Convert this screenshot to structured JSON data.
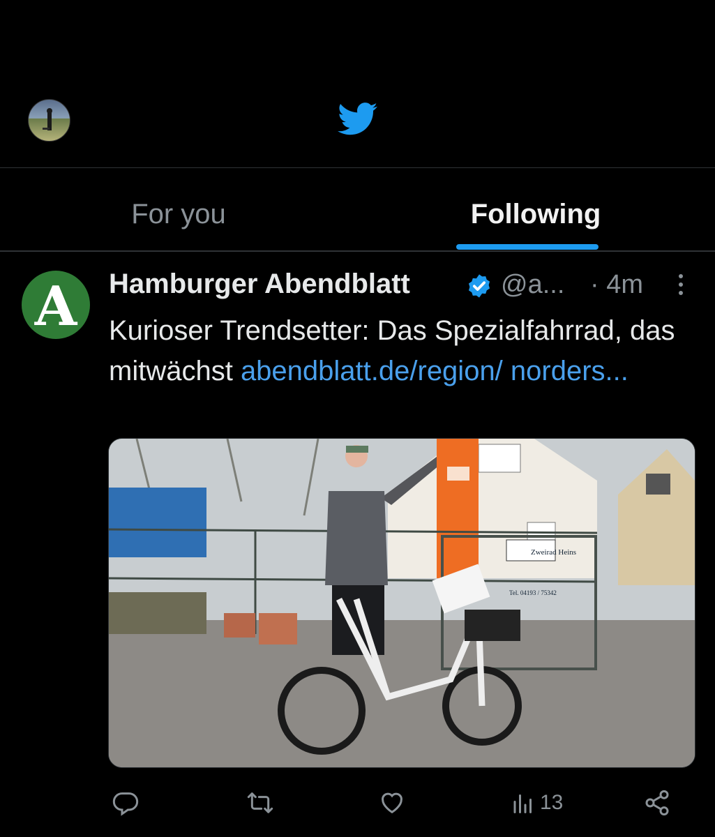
{
  "header": {
    "logo_icon": "twitter-bird-icon",
    "avatar_icon": "profile-avatar"
  },
  "tabs": [
    {
      "label": "For you",
      "active": false
    },
    {
      "label": "Following",
      "active": true
    }
  ],
  "tweet": {
    "author_name": "Hamburger Abendblatt",
    "author_initial": "A",
    "verified": true,
    "handle": "@a...",
    "time": "· 4m",
    "text": "Kurioser Trendsetter: Das Spezialfahrrad, das mitwächst",
    "link": "abendblatt.de/region/ norders...",
    "image_sign": {
      "title": "Zweirad Heins",
      "phone": "Tel. 04193 / 75342"
    },
    "actions": {
      "reply_icon": "reply-icon",
      "retweet_icon": "retweet-icon",
      "like_icon": "heart-icon",
      "views_icon": "views-icon",
      "views_count": "13",
      "share_icon": "share-icon"
    }
  },
  "colors": {
    "accent": "#1d9bf0",
    "link": "#4aa0ec",
    "background": "#000000",
    "muted": "#8b9298"
  }
}
